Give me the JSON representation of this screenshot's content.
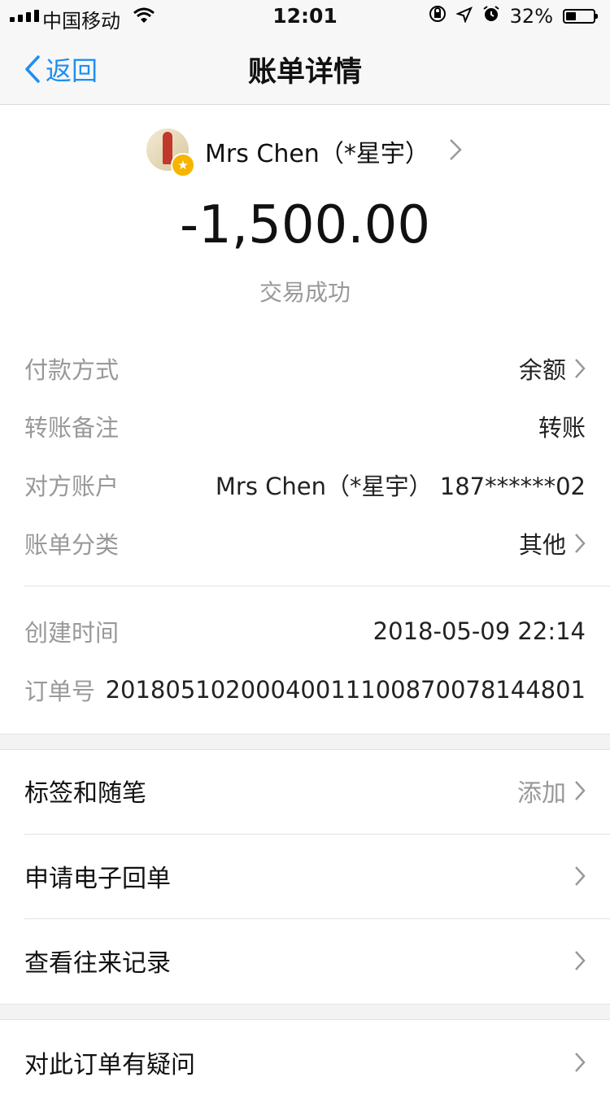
{
  "status_bar": {
    "carrier": "中国移动",
    "time": "12:01",
    "battery": "32%"
  },
  "nav": {
    "back_label": "返回",
    "title": "账单详情"
  },
  "header": {
    "payee": "Mrs Chen（*星宇）",
    "amount": "-1,500.00",
    "status": "交易成功"
  },
  "details": {
    "payment_method_label": "付款方式",
    "payment_method_value": "余额",
    "note_label": "转账备注",
    "note_value": "转账",
    "account_label": "对方账户",
    "account_value": "Mrs Chen（*星宇） 187******02",
    "category_label": "账单分类",
    "category_value": "其他",
    "created_label": "创建时间",
    "created_value": "2018-05-09 22:14",
    "order_label": "订单号",
    "order_value": "20180510200040011100870078144801"
  },
  "actions": {
    "tags_label": "标签和随笔",
    "tags_value": "添加",
    "receipt_label": "申请电子回单",
    "history_label": "查看往来记录",
    "question_label": "对此订单有疑问"
  },
  "colors": {
    "accent": "#1f8ef1",
    "muted": "#999999"
  }
}
